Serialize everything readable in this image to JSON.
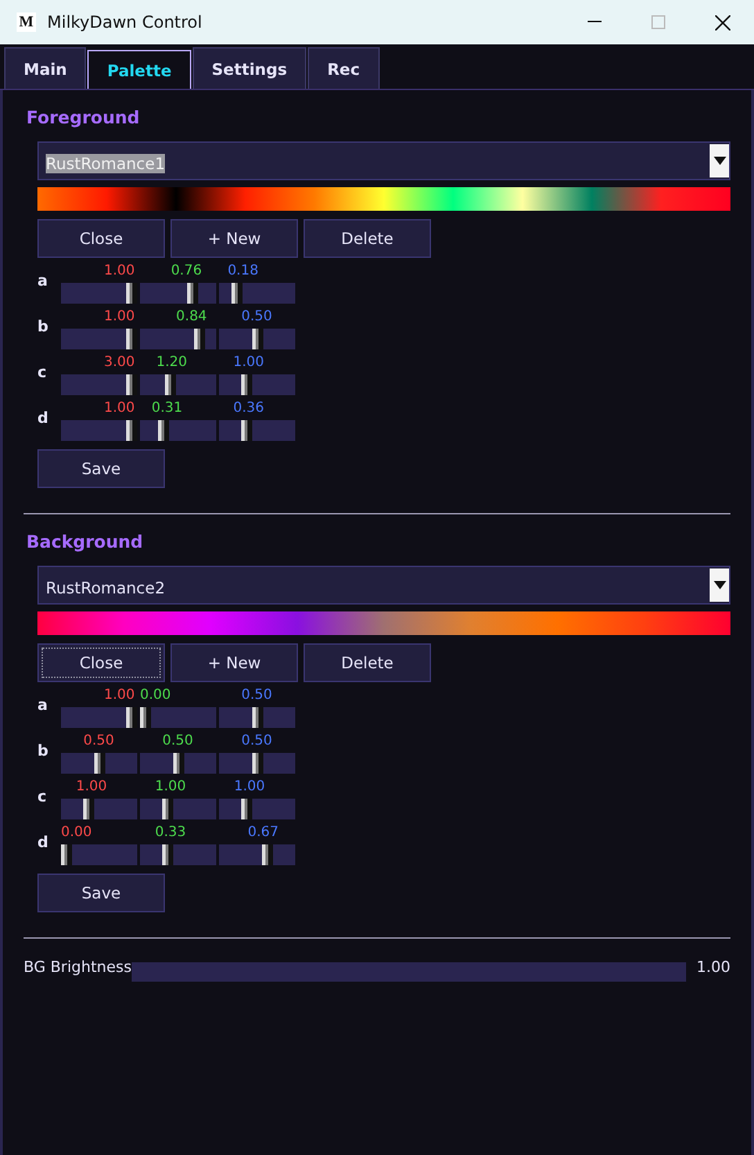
{
  "window": {
    "title": "MilkyDawn Control",
    "logo": "M"
  },
  "tabs": [
    {
      "label": "Main",
      "selected": false
    },
    {
      "label": "Palette",
      "selected": true
    },
    {
      "label": "Settings",
      "selected": false
    },
    {
      "label": "Rec",
      "selected": false
    }
  ],
  "sections": [
    {
      "title": "Foreground",
      "palette": {
        "value": "RustRomance1",
        "highlighted": true
      },
      "buttons": [
        {
          "label": "Close",
          "focused": false
        },
        {
          "label": "+ New",
          "focused": false
        },
        {
          "label": "Delete",
          "focused": false
        }
      ],
      "rows": [
        {
          "label": "a",
          "sliders": [
            {
              "value": "1.00",
              "level": 1
            },
            {
              "value": "0.76",
              "level": 0.72
            },
            {
              "value": "0.18",
              "level": 0.2
            }
          ]
        },
        {
          "label": "b",
          "sliders": [
            {
              "value": "1.00",
              "level": 1
            },
            {
              "value": "0.84",
              "level": 0.84
            },
            {
              "value": "0.50",
              "level": 0.52
            }
          ]
        },
        {
          "label": "c",
          "sliders": [
            {
              "value": "3.00",
              "level": 1
            },
            {
              "value": "1.20",
              "level": 0.38
            },
            {
              "value": "1.00",
              "level": 0.33
            }
          ]
        },
        {
          "label": "d",
          "sliders": [
            {
              "value": "1.00",
              "level": 1
            },
            {
              "value": "0.31",
              "level": 0.27
            },
            {
              "value": "0.36",
              "level": 0.33
            }
          ]
        }
      ],
      "save": "Save"
    },
    {
      "title": "Background",
      "palette": {
        "value": "RustRomance2",
        "highlighted": false
      },
      "buttons": [
        {
          "label": "Close",
          "focused": true
        },
        {
          "label": "+ New",
          "focused": false
        },
        {
          "label": "Delete",
          "focused": false
        }
      ],
      "rows": [
        {
          "label": "a",
          "sliders": [
            {
              "value": "1.00",
              "level": 1
            },
            {
              "value": "0.00",
              "level": 0
            },
            {
              "value": "0.50",
              "level": 0.52
            }
          ]
        },
        {
          "label": "b",
          "sliders": [
            {
              "value": "0.50",
              "level": 0.52
            },
            {
              "value": "0.50",
              "level": 0.52
            },
            {
              "value": "0.50",
              "level": 0.52
            }
          ]
        },
        {
          "label": "c",
          "sliders": [
            {
              "value": "1.00",
              "level": 0.35
            },
            {
              "value": "1.00",
              "level": 0.35
            },
            {
              "value": "1.00",
              "level": 0.35
            }
          ]
        },
        {
          "label": "d",
          "sliders": [
            {
              "value": "0.00",
              "level": 0
            },
            {
              "value": "0.33",
              "level": 0.35
            },
            {
              "value": "0.67",
              "level": 0.67
            }
          ]
        }
      ],
      "save": "Save"
    }
  ],
  "brightness": {
    "label": "BG Brightness",
    "value": "1.00"
  }
}
